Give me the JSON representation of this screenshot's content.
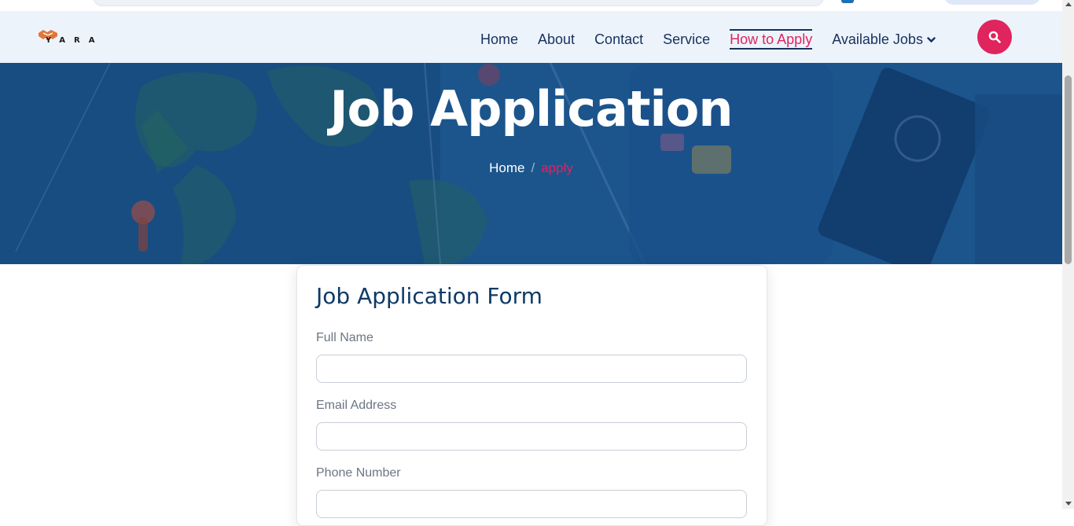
{
  "brand": {
    "logo_text": "YARA"
  },
  "nav": {
    "items": [
      {
        "label": "Home",
        "active": false
      },
      {
        "label": "About",
        "active": false
      },
      {
        "label": "Contact",
        "active": false
      },
      {
        "label": "Service",
        "active": false
      },
      {
        "label": "How to Apply",
        "active": true
      },
      {
        "label": "Available Jobs",
        "active": false,
        "dropdown": true
      }
    ],
    "search_icon": "search-icon"
  },
  "hero": {
    "title": "Job Application",
    "breadcrumb": {
      "home": "Home",
      "separator": "/",
      "current": "apply"
    }
  },
  "form": {
    "title": "Job Application Form",
    "fields": [
      {
        "label": "Full Name",
        "value": ""
      },
      {
        "label": "Email Address",
        "value": ""
      },
      {
        "label": "Phone Number",
        "value": ""
      }
    ]
  },
  "colors": {
    "accent": "#e0245e",
    "navy": "#16325c",
    "nav_bg": "#edf3fb",
    "hero_overlay": "#1d5b95"
  }
}
